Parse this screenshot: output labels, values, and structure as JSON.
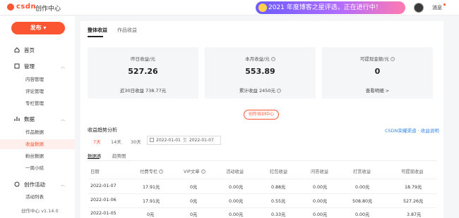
{
  "header": {
    "logo_text": "csdn",
    "title": "创作中心",
    "banner": "2021 年度博客之星评选，正在进行中！",
    "messages": "消息"
  },
  "sidebar": {
    "publish": "发布",
    "groups": [
      {
        "label": "首页",
        "items": []
      },
      {
        "label": "管理",
        "items": [
          "内容管理",
          "评论管理",
          "专栏管理"
        ]
      },
      {
        "label": "数据",
        "items": [
          "作品数据",
          "收益数据",
          "粉丝数据",
          "一周小结"
        ]
      },
      {
        "label": "创作活动",
        "items": [
          "活动列表"
        ]
      }
    ],
    "active_item": "收益数据",
    "version": "创作中心 v1.14.0"
  },
  "main": {
    "tabs": [
      "整体收益",
      "作品收益"
    ],
    "cards": [
      {
        "label": "昨日收益/元",
        "value": "527.26",
        "sub": "近30日收益 738.77元"
      },
      {
        "label": "本月收益/元",
        "value": "553.89",
        "sub": "累计收益 2450元"
      },
      {
        "label": "可提现金额/元",
        "value": "0",
        "sub": "查看明细 >"
      }
    ],
    "training_button": "创作培训中心",
    "trend_title": "收益趋势分析",
    "right_links": "CSDN荣耀渠道 · 收益说明",
    "ranges": [
      "7天",
      "14天",
      "30天"
    ],
    "date_start": "2022-01-01",
    "date_end": "2022-01-07",
    "date_sep": "至",
    "subtabs": [
      "数据表",
      "趋势图"
    ],
    "table": {
      "headers": [
        "日期",
        "付费专栏",
        "VIP文章",
        "活动收益",
        "红包收益",
        "问答收益",
        "打赏收益",
        "可提现收益"
      ],
      "rows": [
        [
          "2022-01-07",
          "17.91元",
          "0元",
          "0.00元",
          "0.88元",
          "0.00元",
          "0.00元",
          "18.79元"
        ],
        [
          "2022-01-06",
          "17.91元",
          "0元",
          "0.00元",
          "0.55元",
          "0.00元",
          "508.80元",
          "527.26元"
        ],
        [
          "2022-01-05",
          "0元",
          "0元",
          "0.00元",
          "0.33元",
          "0.00元",
          "0.00元",
          "3.87元"
        ]
      ]
    }
  }
}
